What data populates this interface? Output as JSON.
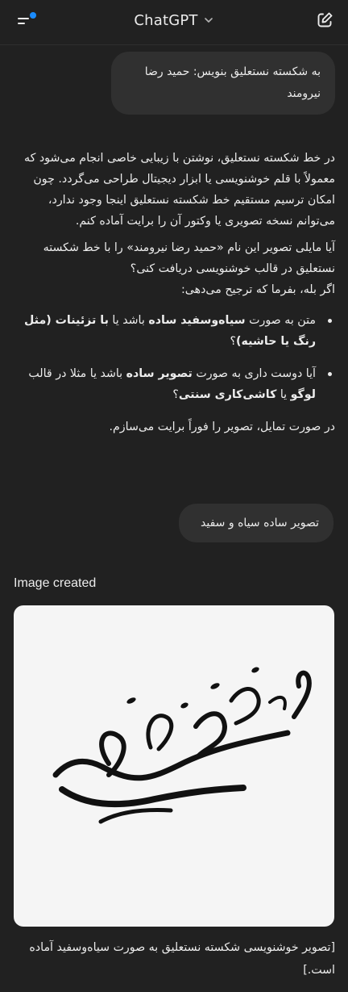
{
  "header": {
    "title": "ChatGPT",
    "icons": {
      "menu": "menu-icon",
      "chevron": "chevron-down-icon",
      "new_chat": "new-chat-icon"
    },
    "colors": {
      "notification_dot": "#1a8cff"
    }
  },
  "messages": {
    "user_1": "به شکسته نستعلیق بنویس: حمید رضا نیرومند",
    "assistant_1": {
      "p1": "در خط شکسته نستعلیق، نوشتن با زیبایی خاصی انجام می‌شود که معمولاً با قلم خوشنویسی یا ابزار دیجیتال طراحی می‌گردد. چون امکان ترسیم مستقیم خط شکسته نستعلیق اینجا وجود ندارد، می‌توانم نسخه تصویری یا وکتور آن را برایت آماده کنم.",
      "p2": "آیا مایلی تصویر این نام «حمید رضا نیرومند» را با خط شکسته نستعلیق در قالب خوشنویسی دریافت کنی؟",
      "p3": "اگر بله، بفرما که ترجیح می‌دهی:",
      "b1_a": "متن به صورت ",
      "b1_b": "سیاه‌وسفید ساده",
      "b1_c": " باشد یا ",
      "b1_d": "با تزئینات (مثل رنگ یا حاشیه)",
      "b1_e": "؟",
      "b2_a": "آیا دوست داری به صورت ",
      "b2_b": "تصویر ساده",
      "b2_c": " باشد یا مثلا در قالب ",
      "b2_d": "لوگو",
      "b2_e": " یا ",
      "b2_f": "کاشی‌کاری سنتی",
      "b2_g": "؟",
      "p4": "در صورت تمایل، تصویر را فوراً برایت می‌سازم."
    },
    "user_2": "تصویر ساده سیاه و سفید",
    "image_created_label": "Image created",
    "caption": "[تصویر خوشنویسی شکسته نستعلیق به صورت سیاه‌وسفید آماده است.]"
  }
}
